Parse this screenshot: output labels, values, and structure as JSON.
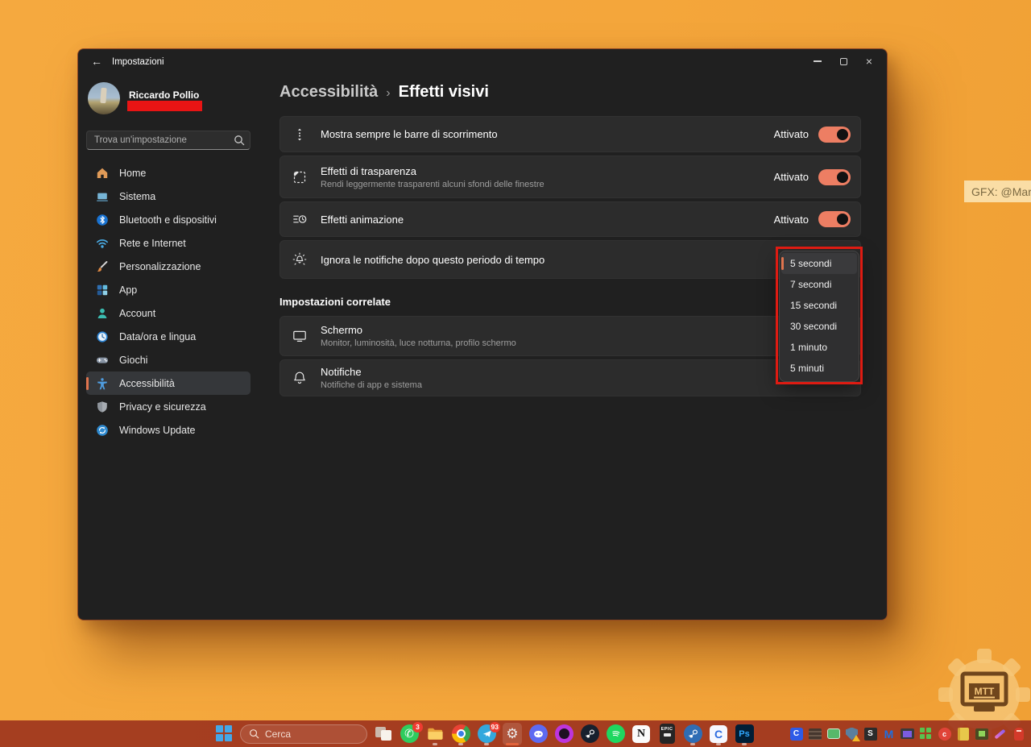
{
  "colors": {
    "accent": "#ED7E63",
    "annotation_red": "#DE1B12",
    "taskbar": "#A53A24",
    "wallpaper": "#F4A63B"
  },
  "desktop": {
    "watermark": "GFX: @Mar",
    "logo_text": "MTT"
  },
  "window": {
    "title": "Impostazioni",
    "back_glyph": "←",
    "close_glyph": "×"
  },
  "profile": {
    "name": "Riccardo Pollio"
  },
  "search": {
    "placeholder": "Trova un'impostazione"
  },
  "sidebar": {
    "items": [
      {
        "icon": "home-icon",
        "label": "Home"
      },
      {
        "icon": "system-icon",
        "label": "Sistema"
      },
      {
        "icon": "bluetooth-icon",
        "label": "Bluetooth e dispositivi"
      },
      {
        "icon": "network-icon",
        "label": "Rete e Internet"
      },
      {
        "icon": "personalization-icon",
        "label": "Personalizzazione"
      },
      {
        "icon": "apps-icon",
        "label": "App"
      },
      {
        "icon": "account-icon",
        "label": "Account"
      },
      {
        "icon": "datetime-icon",
        "label": "Data/ora e lingua"
      },
      {
        "icon": "gaming-icon",
        "label": "Giochi"
      },
      {
        "icon": "accessibility-icon",
        "label": "Accessibilità",
        "selected": true
      },
      {
        "icon": "privacy-icon",
        "label": "Privacy e sicurezza"
      },
      {
        "icon": "windows-update-icon",
        "label": "Windows Update"
      }
    ]
  },
  "header": {
    "breadcrumb_parent": "Accessibilità",
    "breadcrumb_separator": "›",
    "page_title": "Effetti visivi"
  },
  "settings": {
    "rows": [
      {
        "icon": "scrollbar-icon",
        "title": "Mostra sempre le barre di scorrimento",
        "status": "Attivato",
        "control": "toggle-on"
      },
      {
        "icon": "transparency-icon",
        "title": "Effetti di trasparenza",
        "subtitle": "Rendi leggermente trasparenti alcuni sfondi delle finestre",
        "status": "Attivato",
        "control": "toggle-on"
      },
      {
        "icon": "animation-icon",
        "title": "Effetti animazione",
        "status": "Attivato",
        "control": "toggle-on"
      },
      {
        "icon": "dismiss-notifications-icon",
        "title": "Ignora le notifiche dopo questo periodo di tempo",
        "control": "dropdown-open"
      }
    ]
  },
  "dropdown": {
    "selected": "5 secondi",
    "options": [
      "5 secondi",
      "7 secondi",
      "15 secondi",
      "30 secondi",
      "1 minuto",
      "5 minuti"
    ]
  },
  "related": {
    "header": "Impostazioni correlate",
    "items": [
      {
        "icon": "display-icon",
        "title": "Schermo",
        "subtitle": "Monitor, luminosità, luce notturna, profilo schermo"
      },
      {
        "icon": "bell-icon",
        "title": "Notifiche",
        "subtitle": "Notifiche di app e sistema"
      }
    ]
  },
  "taskbar": {
    "search_label": "Cerca",
    "badges": {
      "whatsapp": "3",
      "telegram": "93"
    },
    "glyphs": {
      "whatsapp": "✆",
      "settings": "⚙",
      "notion": "N",
      "epic": "EPIC",
      "clipchamp": "C",
      "photoshop": "Ps",
      "tray_c": "C",
      "tray_s": "S",
      "tray_m": "M",
      "tray_red": "c"
    }
  }
}
